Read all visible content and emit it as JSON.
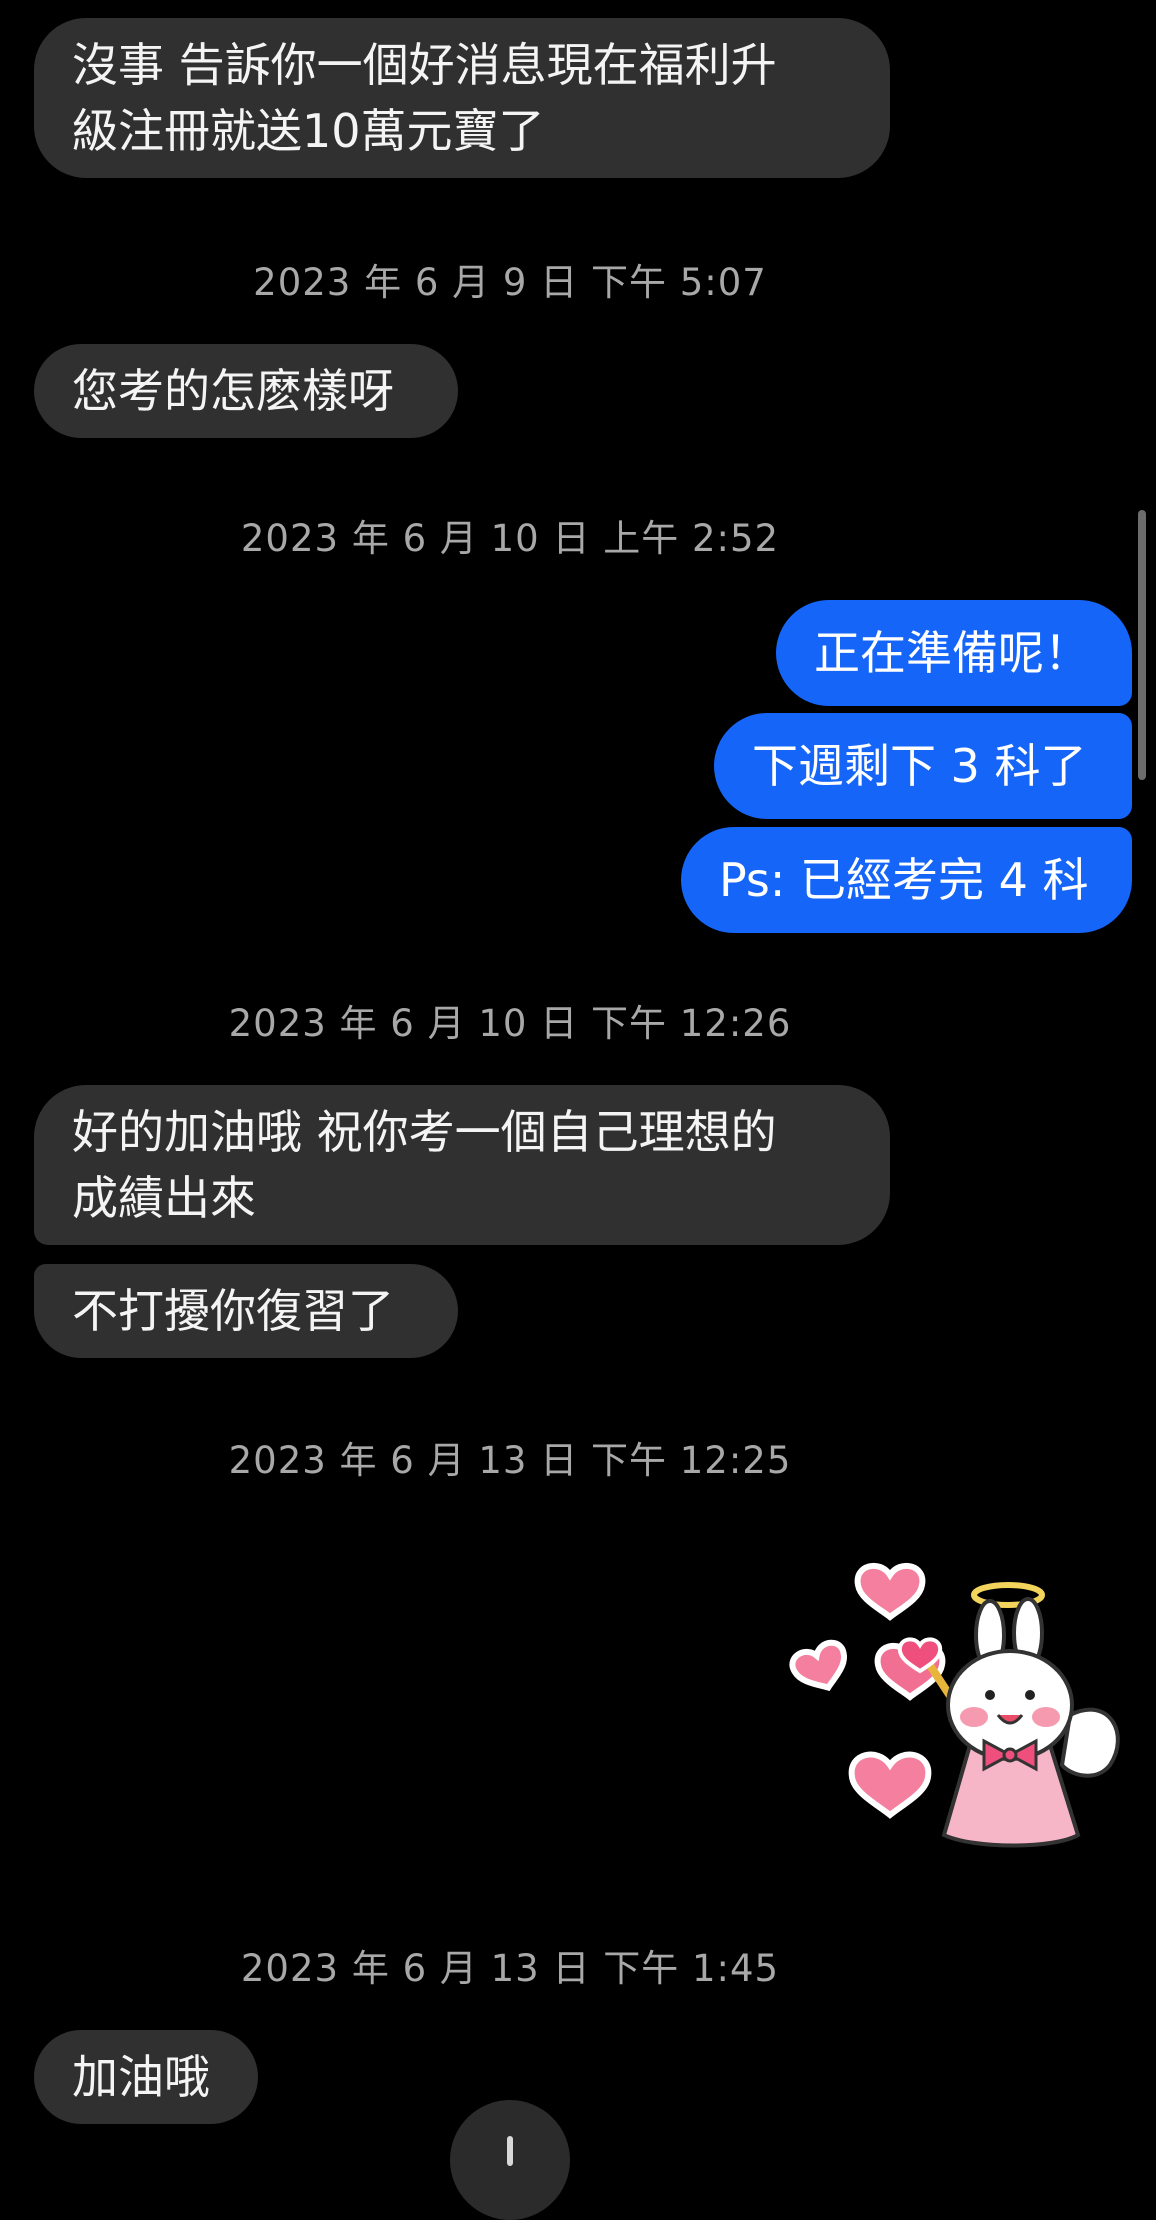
{
  "conversation": {
    "messages": [
      {
        "text": "沒事  告訴你一個好消息現在福利升\n級注冊就送10萬元寶了"
      },
      {
        "text": "您考的怎麽樣呀"
      },
      {
        "text": "正在準備呢！"
      },
      {
        "text": "下週剩下 3 科了"
      },
      {
        "text": "Ps: 已經考完 4 科"
      },
      {
        "text": "好的加油哦  祝你考一個自己理想的\n成績出來"
      },
      {
        "text": "不打擾你復習了"
      },
      {
        "text": "加油哦"
      }
    ],
    "timestamps": [
      "2023 年 6 月 9 日  下午 5:07",
      "2023 年 6 月 10 日  上午 2:52",
      "2023 年 6 月 10 日  下午 12:26",
      "2023 年 6 月 13 日  下午 12:25",
      "2023 年 6 月 13 日  下午 1:45"
    ],
    "sticker": {
      "icon": "angel-bunny-hearts-sticker"
    }
  },
  "colors": {
    "background": "#000000",
    "incoming_bubble": "#303030",
    "outgoing_bubble": "#1565f8",
    "timestamp_text": "#a8a8a8"
  },
  "icons": {
    "scroll_down": "arrow-down-icon"
  }
}
